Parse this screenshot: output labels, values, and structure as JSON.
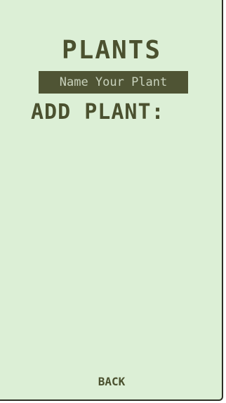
{
  "header": {
    "title": "PLANTS"
  },
  "form": {
    "name_placeholder": "Name Your Plant",
    "add_label": "ADD PLANT:"
  },
  "footer": {
    "back_label": "BACK"
  },
  "colors": {
    "background": "#dcefd6",
    "text": "#4b512f",
    "input_bg": "#4f5434",
    "input_text": "#cdd7c2"
  }
}
